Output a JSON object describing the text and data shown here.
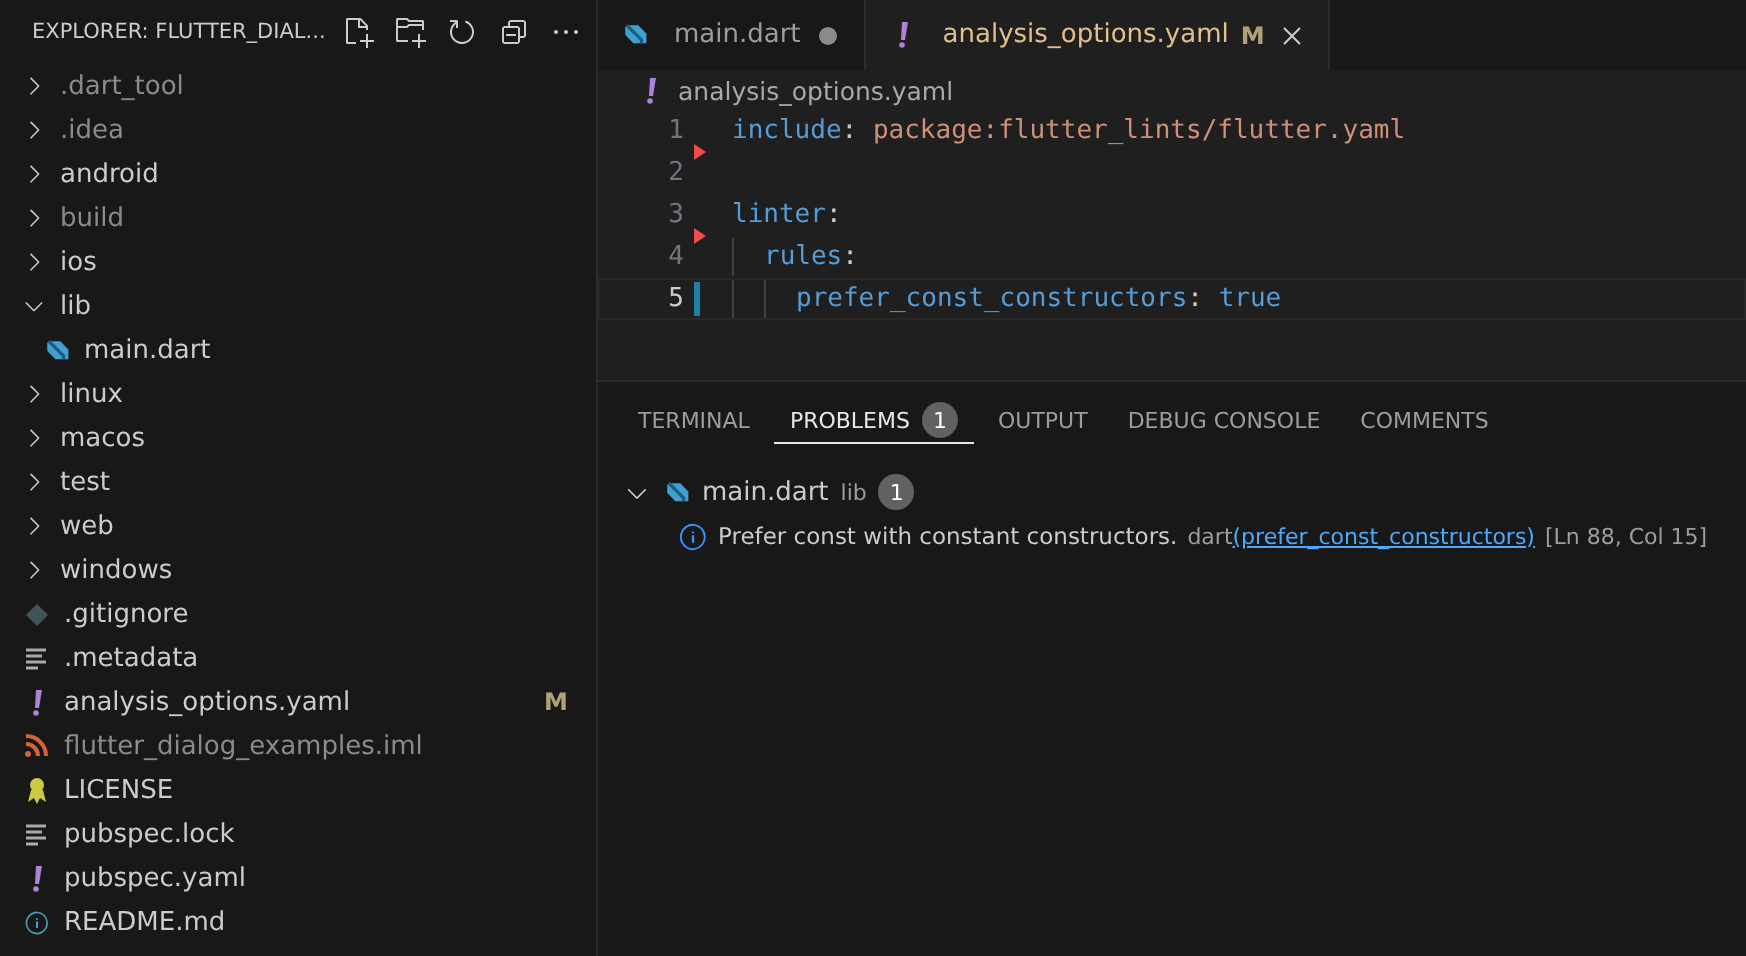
{
  "sidebar": {
    "title": "EXPLORER: FLUTTER_DIAL...",
    "items": [
      {
        "label": ".dart_tool",
        "kind": "folder",
        "expanded": false,
        "dimmed": true
      },
      {
        "label": ".idea",
        "kind": "folder",
        "expanded": false,
        "dimmed": true
      },
      {
        "label": "android",
        "kind": "folder",
        "expanded": false,
        "dimmed": false
      },
      {
        "label": "build",
        "kind": "folder",
        "expanded": false,
        "dimmed": true
      },
      {
        "label": "ios",
        "kind": "folder",
        "expanded": false,
        "dimmed": false
      },
      {
        "label": "lib",
        "kind": "folder",
        "expanded": true,
        "dimmed": false,
        "children": [
          {
            "label": "main.dart",
            "kind": "dart",
            "dimmed": false
          }
        ]
      },
      {
        "label": "linux",
        "kind": "folder",
        "expanded": false,
        "dimmed": false
      },
      {
        "label": "macos",
        "kind": "folder",
        "expanded": false,
        "dimmed": false
      },
      {
        "label": "test",
        "kind": "folder",
        "expanded": false,
        "dimmed": false
      },
      {
        "label": "web",
        "kind": "folder",
        "expanded": false,
        "dimmed": false
      },
      {
        "label": "windows",
        "kind": "folder",
        "expanded": false,
        "dimmed": false
      },
      {
        "label": ".gitignore",
        "kind": "git",
        "dimmed": false
      },
      {
        "label": ".metadata",
        "kind": "text",
        "dimmed": false
      },
      {
        "label": "analysis_options.yaml",
        "kind": "yaml",
        "dimmed": false,
        "badge": "M"
      },
      {
        "label": "flutter_dialog_examples.iml",
        "kind": "rss",
        "dimmed": true
      },
      {
        "label": "LICENSE",
        "kind": "license",
        "dimmed": false
      },
      {
        "label": "pubspec.lock",
        "kind": "text",
        "dimmed": false
      },
      {
        "label": "pubspec.yaml",
        "kind": "yaml",
        "dimmed": false
      },
      {
        "label": "README.md",
        "kind": "info",
        "dimmed": false
      }
    ]
  },
  "tabs": [
    {
      "label": "main.dart",
      "kind": "dart",
      "selected": false,
      "dirty": true
    },
    {
      "label": "analysis_options.yaml",
      "kind": "yaml",
      "selected": true,
      "badge": "M",
      "dirty": false
    }
  ],
  "breadcrumb": "analysis_options.yaml",
  "code": [
    {
      "number": "1",
      "deleted_after": true,
      "modified": false,
      "current": false,
      "tokens": [
        {
          "text": "include",
          "kind": "key"
        },
        {
          "text": ": ",
          "kind": "punct"
        },
        {
          "text": "package:flutter_lints/flutter.yaml",
          "kind": "string"
        }
      ]
    },
    {
      "number": "2",
      "deleted_after": false,
      "modified": false,
      "current": false
    },
    {
      "number": "3",
      "deleted_after": true,
      "modified": false,
      "current": false,
      "tokens": [
        {
          "text": "linter",
          "kind": "key"
        },
        {
          "text": ":",
          "kind": "punct"
        }
      ],
      "children": [
        {
          "number": "4",
          "deleted_after": false,
          "modified": false,
          "current": false,
          "tokens": [
            {
              "text": "rules",
              "kind": "key"
            },
            {
              "text": ":",
              "kind": "punct"
            }
          ],
          "children": [
            {
              "number": "5",
              "deleted_after": false,
              "modified": true,
              "current": true,
              "tokens": [
                {
                  "text": "prefer_const_constructors",
                  "kind": "key"
                },
                {
                  "text": ": ",
                  "kind": "punct"
                },
                {
                  "text": "true",
                  "kind": "bool"
                }
              ]
            }
          ]
        }
      ]
    }
  ],
  "panel": {
    "tabs": [
      {
        "label": "TERMINAL",
        "selected": false
      },
      {
        "label": "PROBLEMS",
        "selected": true,
        "count": "1"
      },
      {
        "label": "OUTPUT",
        "selected": false
      },
      {
        "label": "DEBUG CONSOLE",
        "selected": false
      },
      {
        "label": "COMMENTS",
        "selected": false
      }
    ],
    "problems": [
      {
        "file": "main.dart",
        "folder": "lib",
        "count": "1",
        "expanded": true,
        "entries": [
          {
            "kind": "info",
            "message": "Prefer const with constant constructors.",
            "source": "dart",
            "code": "(prefer_const_constructors)",
            "location": "[Ln 88, Col 15]"
          }
        ]
      }
    ]
  }
}
